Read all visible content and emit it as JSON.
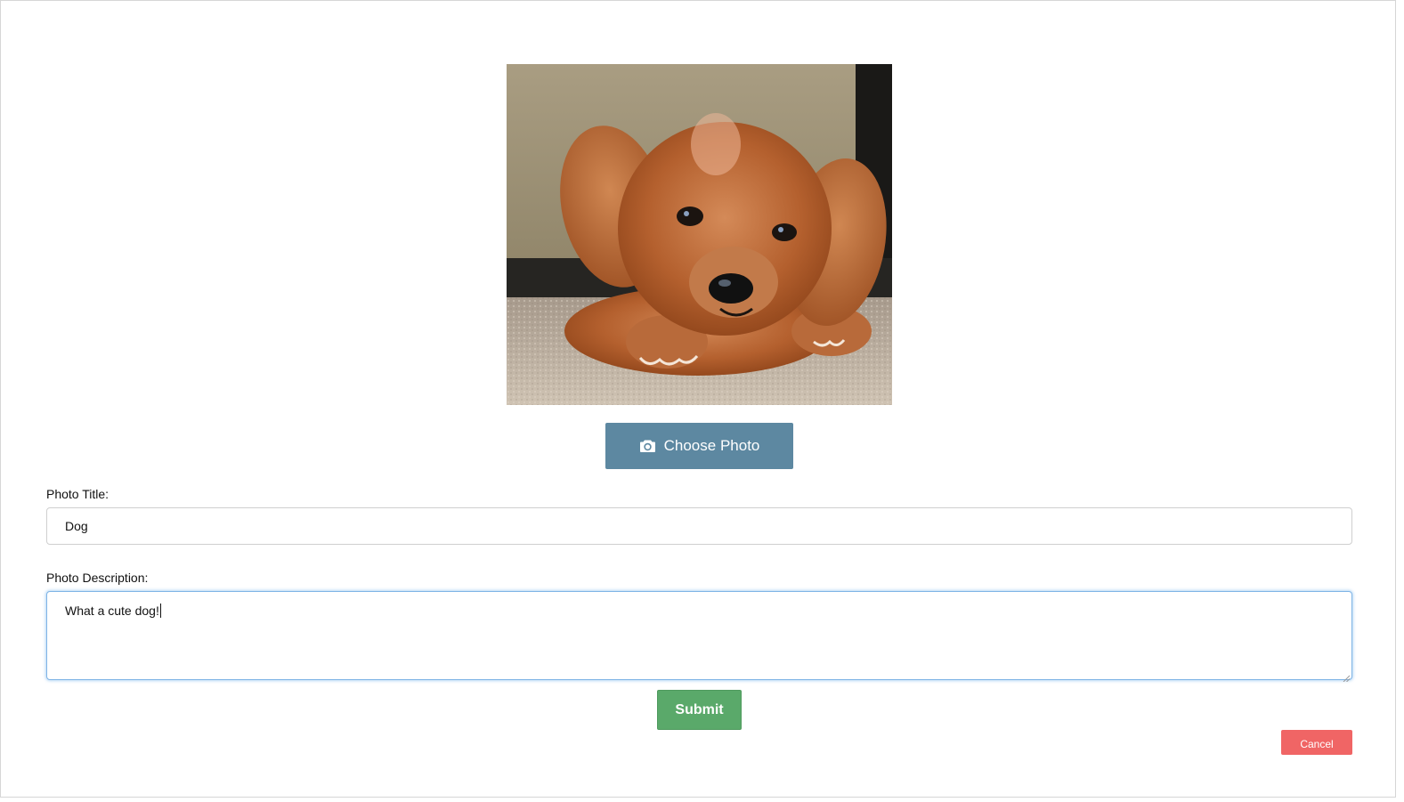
{
  "photo": {
    "subject": "puppy-photo"
  },
  "choose_photo": {
    "label": "Choose Photo",
    "icon": "camera-icon",
    "color": "#5d88a1"
  },
  "title_field": {
    "label": "Photo Title:",
    "value": "Dog"
  },
  "description_field": {
    "label": "Photo Description:",
    "value": "What a cute dog!"
  },
  "submit": {
    "label": "Submit",
    "color": "#5aa96a"
  },
  "cancel": {
    "label": "Cancel",
    "color": "#f06565"
  }
}
